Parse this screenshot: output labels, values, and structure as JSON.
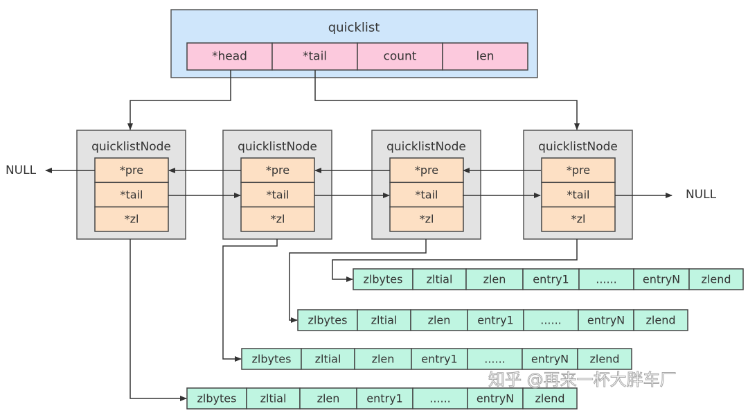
{
  "colors": {
    "quicklist_bg": "#cfe6fb",
    "quicklist_field": "#fcc9dd",
    "node_bg": "#e3e3e3",
    "node_field": "#fde0c4",
    "ziplist_cell": "#bff5e1",
    "stroke": "#333333"
  },
  "quicklist": {
    "title": "quicklist",
    "fields": [
      "*head",
      "*tail",
      "count",
      "len"
    ]
  },
  "nodes": [
    {
      "title": "quicklistNode",
      "fields": [
        "*pre",
        "*tail",
        "*zl"
      ]
    },
    {
      "title": "quicklistNode",
      "fields": [
        "*pre",
        "*tail",
        "*zl"
      ]
    },
    {
      "title": "quicklistNode",
      "fields": [
        "*pre",
        "*tail",
        "*zl"
      ]
    },
    {
      "title": "quicklistNode",
      "fields": [
        "*pre",
        "*tail",
        "*zl"
      ]
    }
  ],
  "null_left": "NULL",
  "null_right": "NULL",
  "ziplist_cells": [
    "zlbytes",
    "zltial",
    "zlen",
    "entry1",
    "......",
    "entryN",
    "zlend"
  ],
  "watermark": "知乎 @再来一杯大胖车厂"
}
